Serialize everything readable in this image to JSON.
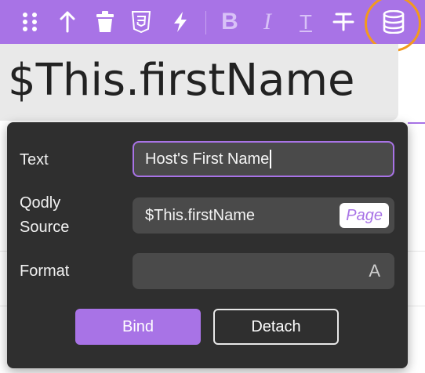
{
  "toolbar": {
    "accent_color": "#a873e6",
    "highlight_color": "#f39a1d",
    "icons": [
      "drag-handle-icon",
      "move-up-icon",
      "trash-icon",
      "css-icon",
      "lightning-icon",
      "bold-icon",
      "italic-icon",
      "text-style-icon",
      "strikethrough-icon",
      "datasource-icon"
    ],
    "bold_label": "B",
    "italic_label": "I",
    "text_label": "T"
  },
  "element": {
    "text": "$This.firstName"
  },
  "popover": {
    "text_label": "Text",
    "text_value": "Host's First Name",
    "source_label_line1": "Qodly",
    "source_label_line2": "Source",
    "source_value": "$This.firstName",
    "source_scope": "Page",
    "format_label": "Format",
    "format_glyph": "A",
    "bind_label": "Bind",
    "detach_label": "Detach"
  }
}
